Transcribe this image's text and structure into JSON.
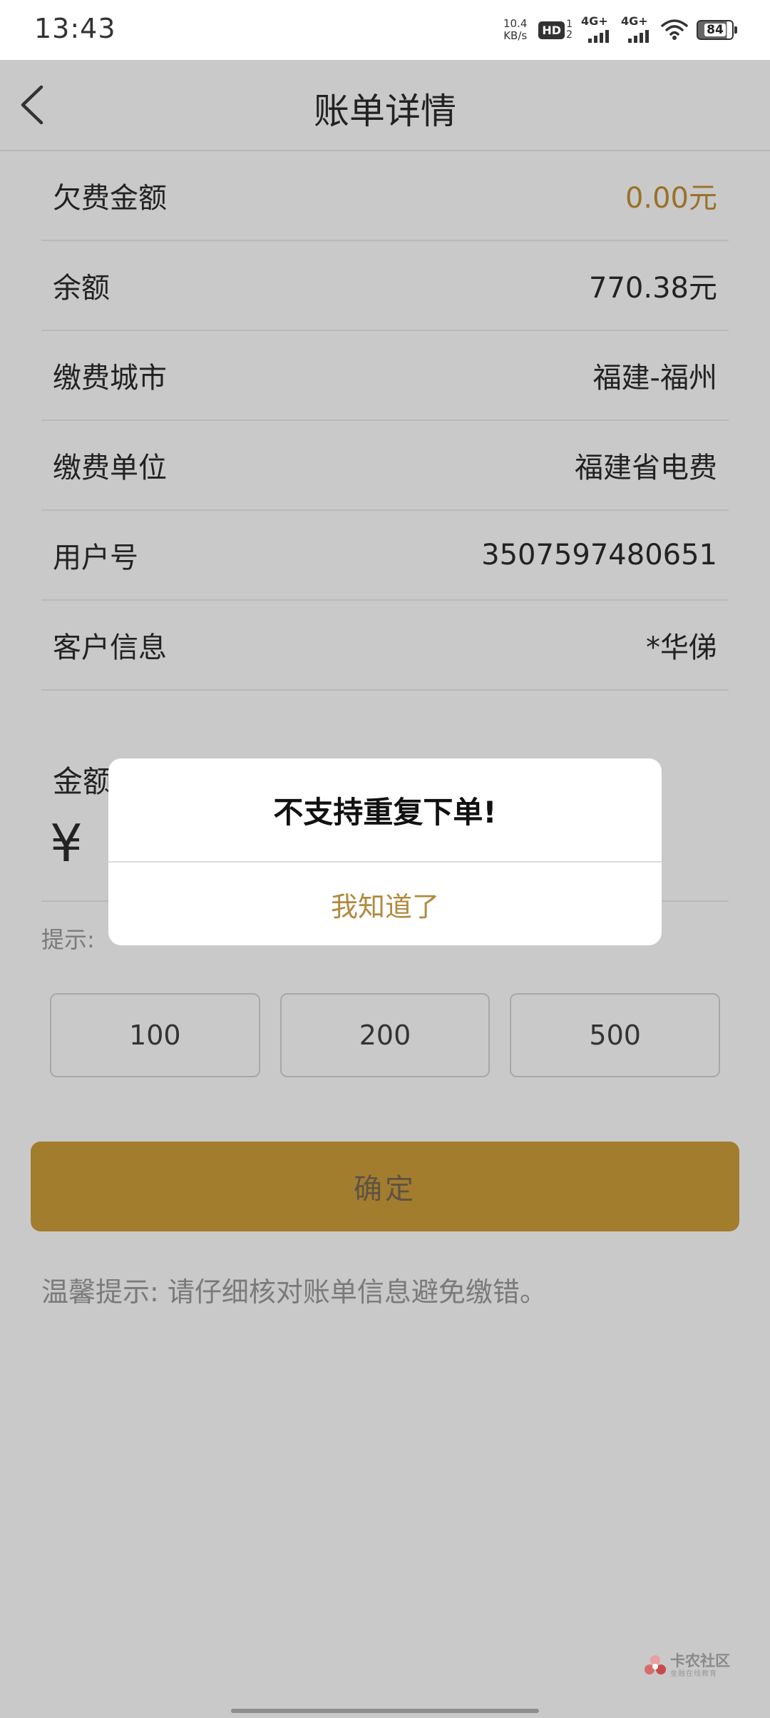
{
  "status_bar": {
    "time": "13:43",
    "net_speed_value": "10.4",
    "net_speed_unit": "KB/s",
    "hd_label": "HD",
    "hd_sub_top": "1",
    "hd_sub_bottom": "2",
    "signal1_label": "4G+",
    "signal2_label": "4G+",
    "battery_level": "84"
  },
  "nav": {
    "title": "账单详情",
    "back_icon": "chevron-left-icon"
  },
  "info_rows": [
    {
      "label": "欠费金额",
      "value": "0.00元",
      "accent": true
    },
    {
      "label": "余额",
      "value": "770.38元",
      "accent": false
    },
    {
      "label": "缴费城市",
      "value": "福建-福州",
      "accent": false
    },
    {
      "label": "缴费单位",
      "value": "福建省电费",
      "accent": false
    },
    {
      "label": "用户号",
      "value": "3507597480651",
      "accent": false
    },
    {
      "label": "客户信息",
      "value": "*华俤",
      "accent": false
    }
  ],
  "amount": {
    "label": "金额",
    "currency_symbol": "¥"
  },
  "hint": "提示:",
  "quick_amounts": [
    "100",
    "200",
    "500"
  ],
  "confirm_label": "确定",
  "warm_tip": "温馨提示:  请仔细核对账单信息避免缴错。",
  "dialog": {
    "message": "不支持重复下单!",
    "button_label": "我知道了"
  },
  "watermark": {
    "main": "卡农社区",
    "sub": "金融在线教育"
  },
  "colors": {
    "overlay_background": "#c9c9c9",
    "accent_gold": "#9a7129",
    "confirm_button": "#a37d2e",
    "dialog_button_text": "#b08a3e"
  }
}
